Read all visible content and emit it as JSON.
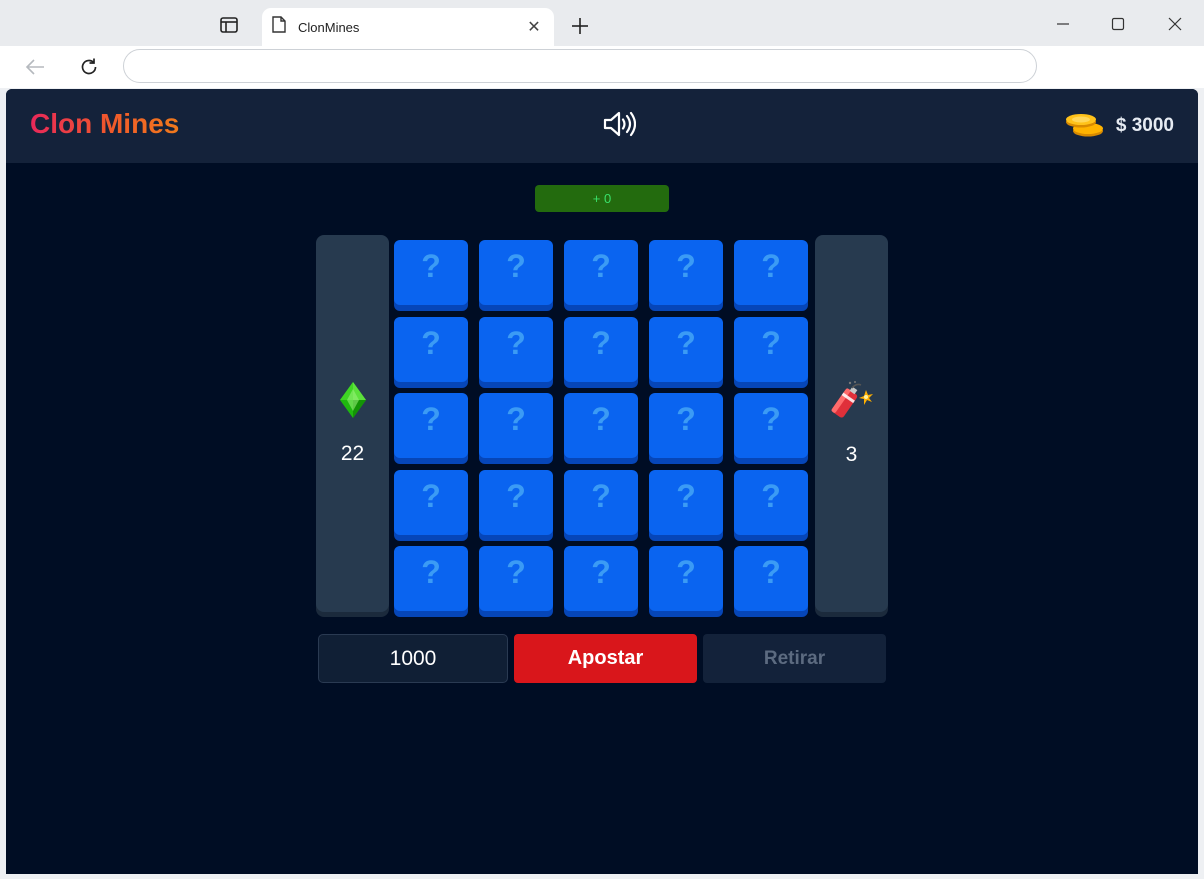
{
  "browser": {
    "tab_title": "ClonMines",
    "tab_close": "✕",
    "address_value": ""
  },
  "app": {
    "title": "Clon Mines",
    "balance": "$ 3000",
    "profit": "+ 0",
    "gems_count": "22",
    "mines_count": "3",
    "tile_symbol": "?",
    "bet_amount": "1000",
    "bet_label": "Apostar",
    "withdraw_label": "Retirar"
  },
  "icons": {
    "sound": "speaker-icon",
    "coins": "coins-icon",
    "gem": "gem-icon",
    "mine": "dynamite-icon"
  },
  "colors": {
    "accent_gradient_start": "#e8285a",
    "accent_gradient_end": "#f07a1c",
    "tile": "#0a64f0",
    "bet_button": "#d9161b",
    "profit_bg": "#236b0e",
    "background": "#000d24"
  },
  "grid": {
    "rows": 5,
    "cols": 5
  }
}
